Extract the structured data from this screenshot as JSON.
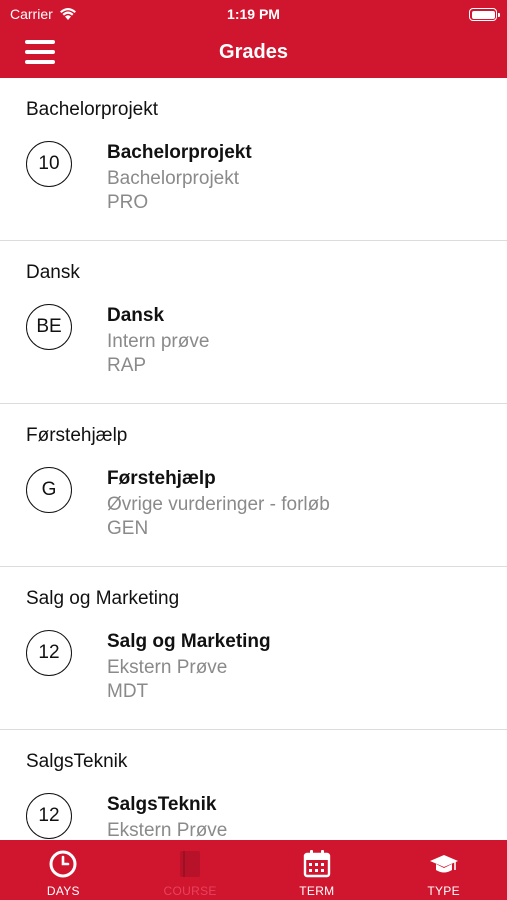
{
  "status": {
    "carrier": "Carrier",
    "time": "1:19 PM"
  },
  "header": {
    "title": "Grades"
  },
  "grades": [
    {
      "section": "Bachelorprojekt",
      "grade": "10",
      "name": "Bachelorprojekt",
      "type": "Bachelorprojekt",
      "code": "PRO"
    },
    {
      "section": "Dansk",
      "grade": "BE",
      "name": "Dansk",
      "type": "Intern prøve",
      "code": "RAP"
    },
    {
      "section": "Førstehjælp",
      "grade": "G",
      "name": "Førstehjælp",
      "type": "Øvrige vurderinger - forløb",
      "code": "GEN"
    },
    {
      "section": "Salg og Marketing",
      "grade": "12",
      "name": "Salg og Marketing",
      "type": "Ekstern Prøve",
      "code": "MDT"
    },
    {
      "section": "SalgsTeknik",
      "grade": "12",
      "name": "SalgsTeknik",
      "type": "Ekstern Prøve",
      "code": ""
    }
  ],
  "tabs": [
    {
      "label": "DAYS",
      "icon": "clock-icon",
      "active": false
    },
    {
      "label": "COURSE",
      "icon": "book-icon",
      "active": true
    },
    {
      "label": "TERM",
      "icon": "calendar-icon",
      "active": false
    },
    {
      "label": "TYPE",
      "icon": "graduation-cap-icon",
      "active": false
    }
  ],
  "colors": {
    "brand": "#d0152f",
    "active_tab": "#e8425d",
    "secondary_text": "#8a8a8a"
  }
}
